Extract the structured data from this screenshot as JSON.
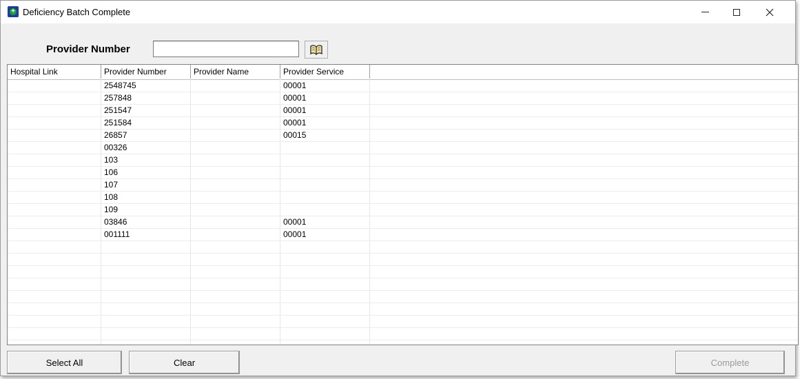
{
  "window": {
    "title": "Deficiency Batch Complete",
    "icon": "app-plus-icon"
  },
  "search": {
    "label": "Provider Number",
    "value": "",
    "lookup_icon": "book-icon"
  },
  "grid": {
    "columns": [
      "Hospital Link",
      "Provider Number",
      "Provider Name",
      "Provider Service"
    ],
    "rows": [
      {
        "hospital_link": "",
        "provider_number": "2548745",
        "provider_name": "",
        "provider_service": "00001"
      },
      {
        "hospital_link": "",
        "provider_number": "257848",
        "provider_name": "",
        "provider_service": "00001"
      },
      {
        "hospital_link": "",
        "provider_number": "251547",
        "provider_name": "",
        "provider_service": "00001"
      },
      {
        "hospital_link": "",
        "provider_number": "251584",
        "provider_name": "",
        "provider_service": "00001"
      },
      {
        "hospital_link": "",
        "provider_number": "26857",
        "provider_name": "",
        "provider_service": "00015"
      },
      {
        "hospital_link": "",
        "provider_number": "00326",
        "provider_name": "",
        "provider_service": ""
      },
      {
        "hospital_link": "",
        "provider_number": "103",
        "provider_name": "",
        "provider_service": ""
      },
      {
        "hospital_link": "",
        "provider_number": "106",
        "provider_name": "",
        "provider_service": ""
      },
      {
        "hospital_link": "",
        "provider_number": "107",
        "provider_name": "",
        "provider_service": ""
      },
      {
        "hospital_link": "",
        "provider_number": "108",
        "provider_name": "",
        "provider_service": ""
      },
      {
        "hospital_link": "",
        "provider_number": "109",
        "provider_name": "",
        "provider_service": ""
      },
      {
        "hospital_link": "",
        "provider_number": "03846",
        "provider_name": "",
        "provider_service": "00001"
      },
      {
        "hospital_link": "",
        "provider_number": "001111",
        "provider_name": "",
        "provider_service": "00001"
      }
    ]
  },
  "buttons": {
    "select_all": "Select All",
    "clear": "Clear",
    "complete": "Complete"
  }
}
